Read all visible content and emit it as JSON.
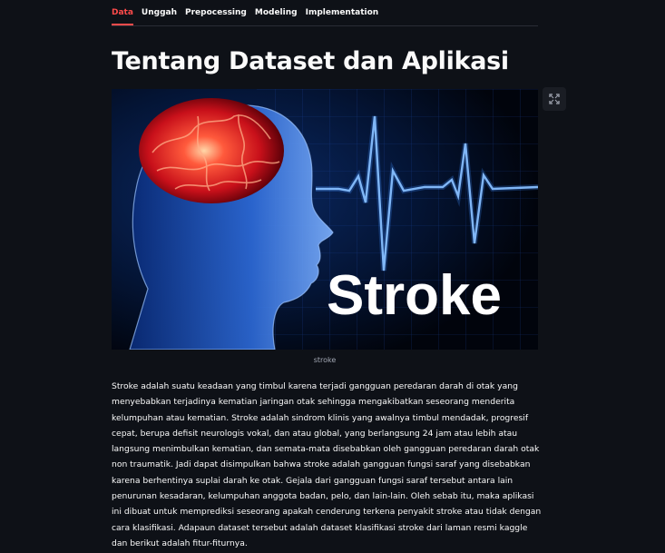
{
  "tabs": [
    "Data",
    "Unggah",
    "Prepocessing",
    "Modeling",
    "Implementation"
  ],
  "active_tab": "Data",
  "title": "Tentang Dataset dan Aplikasi",
  "image": {
    "overlay_text": "Stroke",
    "caption": "stroke"
  },
  "description": "Stroke adalah suatu keadaan yang timbul karena terjadi gangguan peredaran darah di otak yang menyebabkan terjadinya kematian jaringan otak sehingga mengakibatkan seseorang menderita kelumpuhan atau kematian. Stroke adalah sindrom klinis yang awalnya timbul mendadak, progresif cepat, berupa defisit neurologis vokal, dan atau global, yang berlangsung 24 jam atau lebih atau langsung menimbulkan kematian, dan semata-mata disebabkan oleh gangguan peredaran darah otak non traumatik. Jadi dapat disimpulkan bahwa stroke adalah gangguan fungsi saraf yang disebabkan karena berhentinya suplai darah ke otak. Gejala dari gangguan fungsi saraf tersebut antara lain penurunan kesadaran, kelumpuhan anggota badan, pelo, dan lain-lain. Oleh sebab itu, maka aplikasi ini dibuat untuk memprediksi seseorang apakah cenderung terkena penyakit stroke atau tidak dengan cara klasifikasi. Adapaun dataset tersebut adalah dataset klasifikasi stroke dari laman resmi kaggle dan berikut adalah fitur-fiturnya.",
  "colors": {
    "background": "#0e1117",
    "accent": "#ff4b4b",
    "text": "#fafafa"
  },
  "icons": {
    "fullscreen": "fullscreen-icon"
  }
}
